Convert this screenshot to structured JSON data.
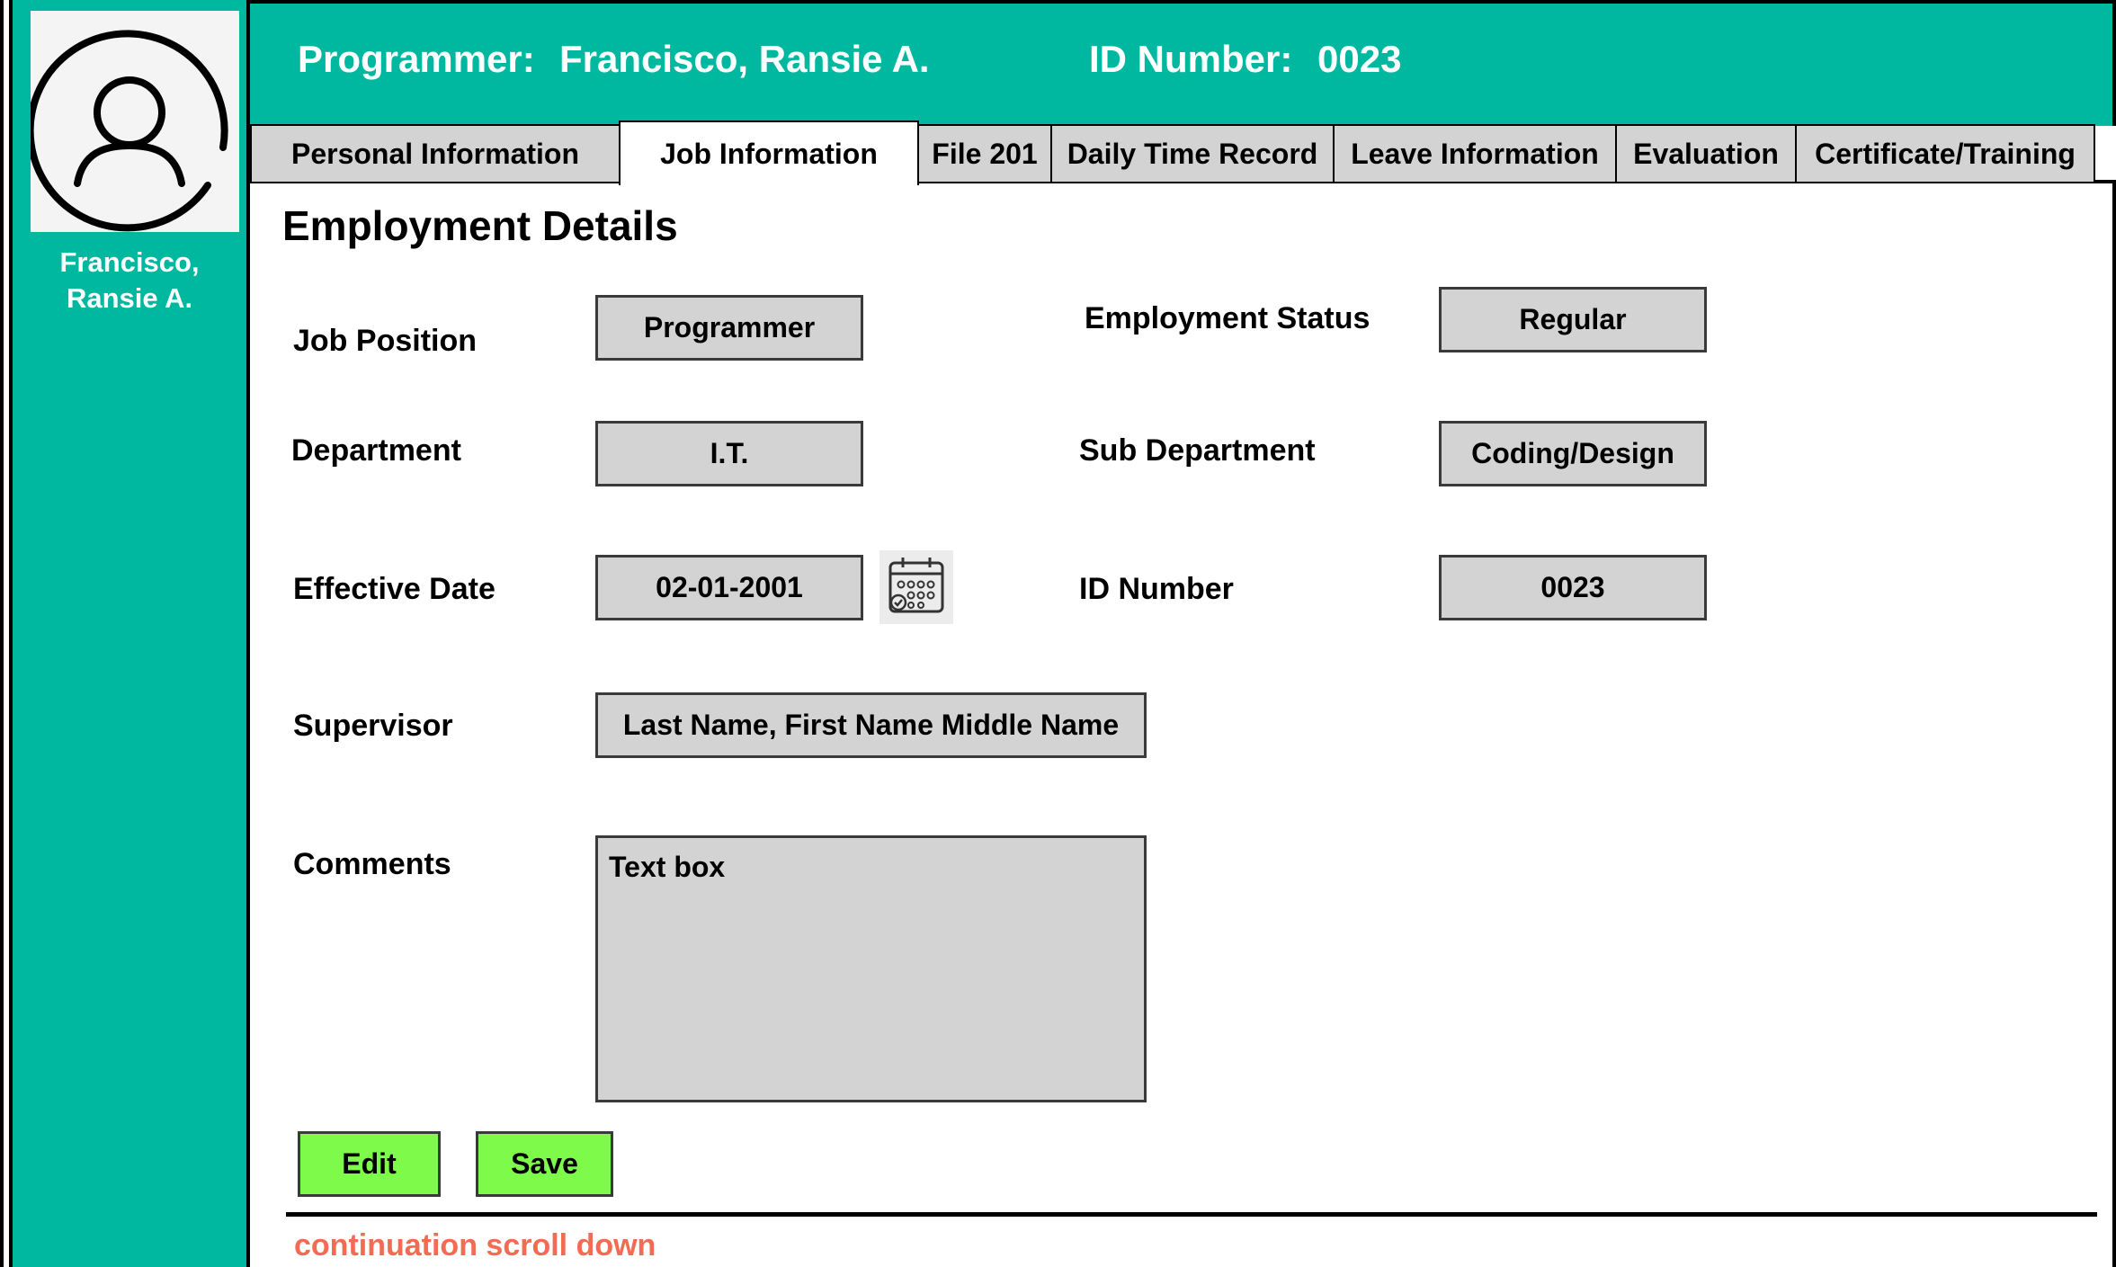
{
  "header": {
    "programmer_label": "Programmer:",
    "programmer_name": "Francisco, Ransie A.",
    "id_label": "ID Number:",
    "id_value": "0023"
  },
  "sidebar": {
    "name_line1": "Francisco,",
    "name_line2": "Ransie A."
  },
  "tabs": [
    {
      "label": "Personal Information"
    },
    {
      "label": "Job Information",
      "active": true
    },
    {
      "label": "File 201"
    },
    {
      "label": "Daily Time Record"
    },
    {
      "label": "Leave Information"
    },
    {
      "label": "Evaluation"
    },
    {
      "label": "Certificate/Training"
    }
  ],
  "section_title": "Employment Details",
  "form": {
    "job_position": {
      "label": "Job Position",
      "value": "Programmer"
    },
    "employment_status": {
      "label": "Employment Status",
      "value": "Regular"
    },
    "department": {
      "label": "Department",
      "value": "I.T."
    },
    "sub_department": {
      "label": "Sub Department",
      "value": "Coding/Design"
    },
    "effective_date": {
      "label": "Effective Date",
      "value": "02-01-2001"
    },
    "id_number": {
      "label": "ID Number",
      "value": "0023"
    },
    "supervisor": {
      "label": "Supervisor",
      "value": "Last Name, First Name Middle Name"
    },
    "comments": {
      "label": "Comments",
      "value": "Text box"
    }
  },
  "buttons": {
    "edit": "Edit",
    "save": "Save"
  },
  "scroll_note": "continuation scroll down",
  "icons": {
    "avatar": "user-avatar-icon",
    "calendar": "calendar-icon"
  },
  "colors": {
    "accent": "#00b89f",
    "button": "#7dfa4a",
    "field": "#d3d3d3",
    "note": "#f26b52"
  }
}
